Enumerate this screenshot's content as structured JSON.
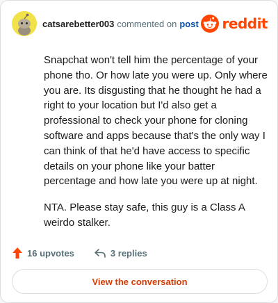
{
  "header": {
    "username": "catsarebetter003",
    "action": "commented on",
    "post_link": "post",
    "brand": "reddit"
  },
  "comment": {
    "paragraphs": [
      "Snapchat won't tell him the percentage of your phone tho. Or how late you were up. Only where you are. Its disgusting that he thought he had a right to your location but I'd also get a professional to check your phone for cloning software and apps because that's the only way I can think of that he'd have access to specific details on your phone like your batter percentage and how late you were up at night.",
      "NTA. Please stay safe, this guy is a Class A weirdo stalker."
    ]
  },
  "stats": {
    "upvotes": "16 upvotes",
    "replies": "3 replies"
  },
  "footer": {
    "view_button": "View the conversation"
  },
  "colors": {
    "brand": "#ff4500",
    "upvote": "#ff4500",
    "link": "#0a4fa8",
    "button_text": "#d93a00"
  },
  "icons": {
    "avatar": "snoo-avatar",
    "logo": "reddit-snoo-icon",
    "upvote": "upvote-arrow-icon",
    "reply": "reply-arrow-icon"
  }
}
